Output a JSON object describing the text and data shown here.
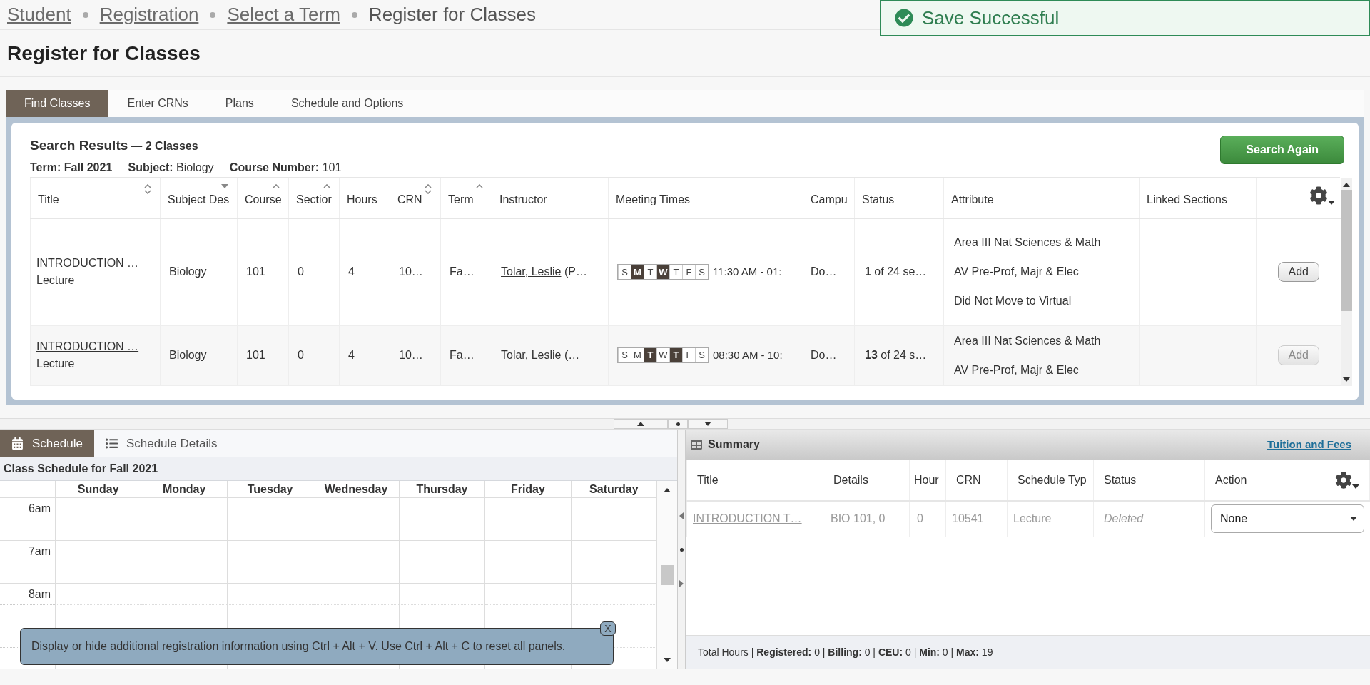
{
  "breadcrumb": [
    {
      "label": "Student",
      "link": true
    },
    {
      "label": "Registration",
      "link": true
    },
    {
      "label": "Select a Term",
      "link": true
    },
    {
      "label": "Register for Classes",
      "link": false
    }
  ],
  "toast": {
    "message": "Save Successful"
  },
  "page_title": "Register for Classes",
  "tabs": [
    {
      "label": "Find Classes",
      "selected": true
    },
    {
      "label": "Enter CRNs",
      "selected": false
    },
    {
      "label": "Plans",
      "selected": false
    },
    {
      "label": "Schedule and Options",
      "selected": false
    }
  ],
  "search": {
    "heading": "Search Results",
    "count": "— 2 Classes",
    "criteria": "**Term: Fall 2021**     **Subject:** Biology     **Course Number:** 101",
    "button": "Search Again"
  },
  "results": {
    "columns": [
      {
        "label": "Title",
        "kind": "sortable"
      },
      {
        "label": "Subject Des",
        "kind": "filter"
      },
      {
        "label": "Course",
        "kind": "sorted"
      },
      {
        "label": "Sectior",
        "kind": "sorted"
      },
      {
        "label": "Hours",
        "kind": "plain"
      },
      {
        "label": "CRN",
        "kind": "sortable"
      },
      {
        "label": "Term",
        "kind": "sorted"
      },
      {
        "label": "Instructor",
        "kind": "plain"
      },
      {
        "label": "Meeting Times",
        "kind": "plain"
      },
      {
        "label": "Campu",
        "kind": "plain"
      },
      {
        "label": "Status",
        "kind": "plain"
      },
      {
        "label": "Attribute",
        "kind": "plain"
      },
      {
        "label": "Linked Sections",
        "kind": "plain"
      }
    ],
    "rows": [
      {
        "title": "INTRODUCTION …",
        "schedule_type": "Lecture",
        "subject": "Biology",
        "course": "101",
        "section": "0",
        "hours": "4",
        "crn": "10…",
        "term": "Fa…",
        "instructor": "Tolar, Leslie",
        "instructor_suffix": "(P…",
        "days": [
          {
            "label": "S",
            "selected": false
          },
          {
            "label": "M",
            "selected": true
          },
          {
            "label": "T",
            "selected": false
          },
          {
            "label": "W",
            "selected": true
          },
          {
            "label": "T",
            "selected": false
          },
          {
            "label": "F",
            "selected": false
          },
          {
            "label": "S",
            "selected": false
          }
        ],
        "time": "11:30 AM - 01:",
        "campus": "Do…",
        "status": "**1** of 24 se…",
        "attributes": [
          "Area III Nat Sciences & Math",
          "AV Pre-Prof, Majr & Elec",
          "Did Not Move to Virtual"
        ],
        "action": "Add",
        "disabled": false
      },
      {
        "title": "INTRODUCTION …",
        "schedule_type": "Lecture",
        "subject": "Biology",
        "course": "101",
        "section": "0",
        "hours": "4",
        "crn": "10…",
        "term": "Fa…",
        "instructor": "Tolar, Leslie",
        "instructor_suffix": "(…",
        "days": [
          {
            "label": "S",
            "selected": false
          },
          {
            "label": "M",
            "selected": false
          },
          {
            "label": "T",
            "selected": true
          },
          {
            "label": "W",
            "selected": false
          },
          {
            "label": "T",
            "selected": true
          },
          {
            "label": "F",
            "selected": false
          },
          {
            "label": "S",
            "selected": false
          }
        ],
        "time": "08:30 AM - 10:",
        "campus": "Do…",
        "status": "**13** of 24 s…",
        "attributes": [
          "Area III Nat Sciences & Math",
          "AV Pre-Prof, Majr & Elec"
        ],
        "action": "Add",
        "disabled": true
      }
    ]
  },
  "schedule_tabs": [
    {
      "label": "Schedule",
      "kind": "calendar",
      "selected": true
    },
    {
      "label": "Schedule Details",
      "kind": "list",
      "selected": false
    }
  ],
  "calendar": {
    "title": "Class Schedule for Fall 2021",
    "days": [
      "Sunday",
      "Monday",
      "Tuesday",
      "Wednesday",
      "Thursday",
      "Friday",
      "Saturday"
    ],
    "hours": [
      "6am",
      "7am",
      "8am"
    ]
  },
  "tip": {
    "text": "Display or hide additional registration information using Ctrl + Alt + V. Use Ctrl + Alt + C to reset all panels.",
    "close": "X"
  },
  "summary": {
    "title": "Summary",
    "link": "Tuition and Fees",
    "columns": [
      "Title",
      "Details",
      "Hour",
      "CRN",
      "Schedule Typ",
      "Status",
      "Action"
    ],
    "rows": [
      {
        "title": "INTRODUCTION T…",
        "details": "BIO 101, 0",
        "hours": "0",
        "crn": "10541",
        "schedule_type": "Lecture",
        "status": "Deleted",
        "action": "None"
      }
    ],
    "totals": "Total Hours | **Registered:** 0 | **Billing:** 0 | **CEU:** 0 | **Min:** 0 | **Max:** 19"
  }
}
